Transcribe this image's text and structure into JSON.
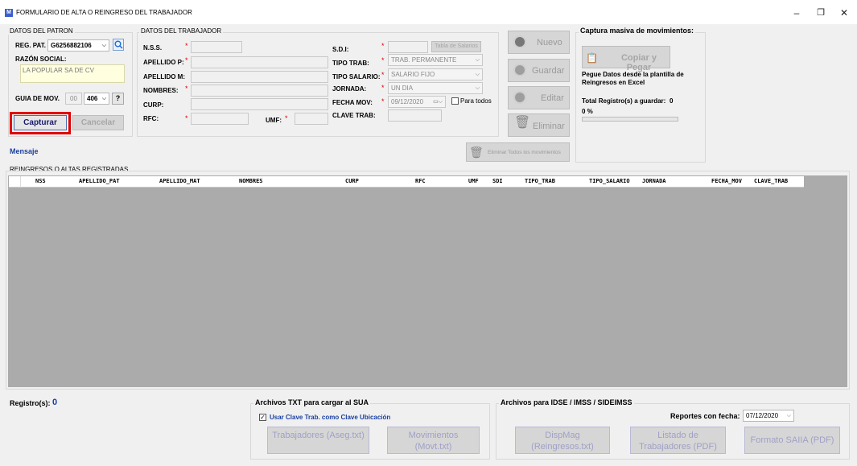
{
  "window": {
    "title": "FORMULARIO DE ALTA O REINGRESO DEL TRABAJADOR",
    "app_icon": "M",
    "controls": [
      "–",
      "❐",
      "✕"
    ]
  },
  "patron": {
    "group_title": "DATOS DEL PATRON",
    "reg_pat_label": "REG. PAT.",
    "reg_pat_value": "G6256882106",
    "razon_social_label": "RAZÓN SOCIAL:",
    "razon_social_value": "LA POPULAR SA DE CV",
    "guia_label": "GUIA DE MOV.",
    "guia_prefix": "00",
    "guia_value": "406",
    "help_label": "?",
    "capturar": "Capturar",
    "cancelar": "Cancelar"
  },
  "trabajador": {
    "group_title": "DATOS DEL TRABAJADOR",
    "nss_label": "N.S.S.",
    "apellido_p_label": "APELLIDO P:",
    "apellido_m_label": "APELLIDO M:",
    "nombres_label": "NOMBRES:",
    "curp_label": "CURP:",
    "rfc_label": "RFC:",
    "umf_label": "UMF:",
    "sdi_label": "S.D.I:",
    "tabla_salarios": "Tabla de Salarios",
    "tipo_trab_label": "TIPO TRAB:",
    "tipo_trab_value": "TRAB. PERMANENTE",
    "tipo_salario_label": "TIPO SALARIO:",
    "tipo_salario_value": "SALARIO FIJO",
    "jornada_label": "JORNADA:",
    "jornada_value": "UN DIA",
    "fecha_mov_label": "FECHA MOV:",
    "fecha_mov_value": "09/12/2020",
    "para_todos": "Para todos",
    "clave_trab_label": "CLAVE TRAB:"
  },
  "actions": {
    "nuevo": "Nuevo",
    "guardar": "Guardar",
    "editar": "Editar",
    "eliminar": "Eliminar",
    "eliminar_todos": "Eliminar Todos los movimientos"
  },
  "masiva": {
    "title": "Captura masiva de movimientos:",
    "copiar_pegar": "Copiar y Pegar",
    "instructions": "Pegue Datos desde la plantilla de Reingresos en Excel",
    "total_label": "Total Registro(s) a guardar:",
    "total_value": "0",
    "progress_text": "0 %",
    "progress": 0
  },
  "mensaje_label": "Mensaje",
  "table": {
    "title": "REINGRESOS O ALTAS REGISTRADAS",
    "columns": [
      "NSS",
      "APELLIDO_PAT",
      "APELLIDO_MAT",
      "NOMBRES",
      "CURP",
      "RFC",
      "UMF",
      "SDI",
      "TIPO_TRAB",
      "TIPO_SALARIO",
      "JORNADA",
      "FECHA_MOV",
      "CLAVE_TRAB"
    ]
  },
  "footer": {
    "registros_label": "Registro(s):",
    "registros_value": "0",
    "sua_title": "Archivos  TXT para cargar al SUA",
    "clave_ubicacion": "Usar Clave Trab. como Clave Ubicación",
    "trabajadores_btn": "Trabajadores (Aseg.txt)",
    "movimientos_btn": "Movimientos (Movt.txt)",
    "idse_title": "Archivos para IDSE / IMSS / SIDEIMSS",
    "reportes_label": "Reportes con fecha:",
    "reportes_fecha": "07/12/2020",
    "dispmag_btn": "DispMag (Reingresos.txt)",
    "listado_btn": "Listado de Trabajadores (PDF)",
    "formato_btn": "Formato SAIIA (PDF)"
  }
}
